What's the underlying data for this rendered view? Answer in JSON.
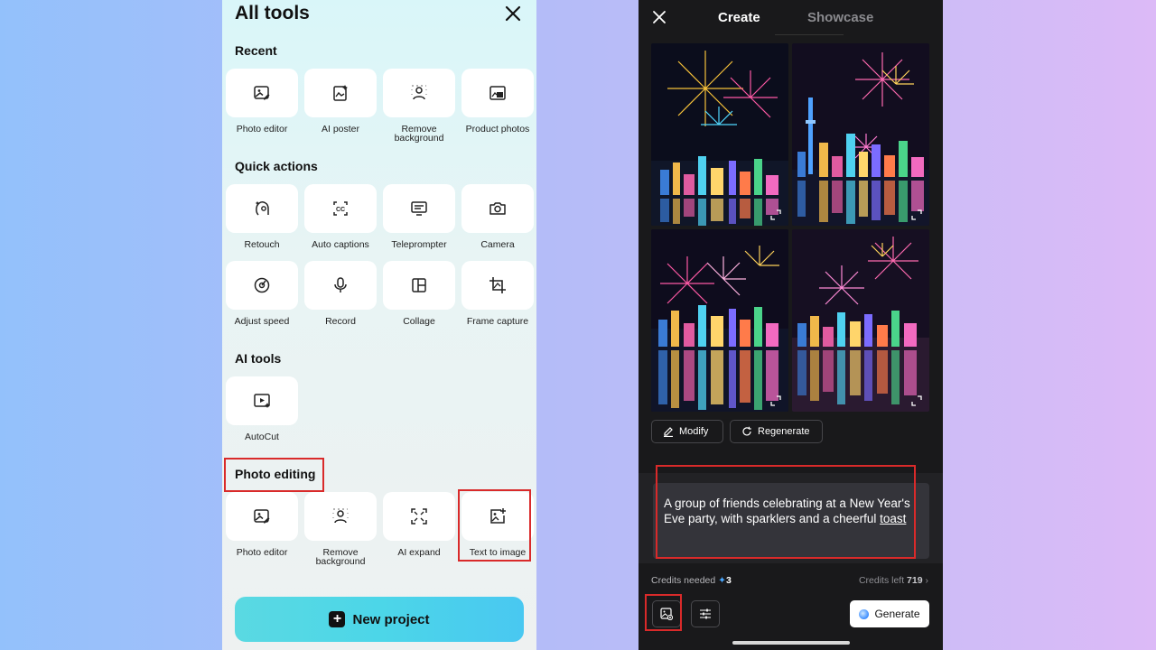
{
  "left_panel": {
    "title": "All tools",
    "sections": {
      "recent": {
        "title": "Recent",
        "items": [
          {
            "label": "Photo editor",
            "icon": "photo-edit-icon"
          },
          {
            "label": "AI poster",
            "icon": "ai-poster-icon"
          },
          {
            "label": "Remove background",
            "icon": "remove-background-icon"
          },
          {
            "label": "Product photos",
            "icon": "product-photos-icon"
          }
        ]
      },
      "quick_actions": {
        "title": "Quick actions",
        "items": [
          {
            "label": "Retouch",
            "icon": "retouch-icon"
          },
          {
            "label": "Auto captions",
            "icon": "captions-icon"
          },
          {
            "label": "Teleprompter",
            "icon": "teleprompter-icon"
          },
          {
            "label": "Camera",
            "icon": "camera-icon"
          },
          {
            "label": "Adjust speed",
            "icon": "speed-icon"
          },
          {
            "label": "Record",
            "icon": "microphone-icon"
          },
          {
            "label": "Collage",
            "icon": "collage-icon"
          },
          {
            "label": "Frame capture",
            "icon": "crop-icon"
          }
        ]
      },
      "ai_tools": {
        "title": "AI tools",
        "items": [
          {
            "label": "AutoCut",
            "icon": "autocut-icon"
          }
        ]
      },
      "photo_editing": {
        "title": "Photo editing",
        "items": [
          {
            "label": "Photo editor",
            "icon": "photo-edit-icon"
          },
          {
            "label": "Remove background",
            "icon": "remove-background-icon"
          },
          {
            "label": "AI expand",
            "icon": "expand-icon"
          },
          {
            "label": "Text to image",
            "icon": "image-plus-icon"
          }
        ]
      }
    },
    "new_project_label": "New project"
  },
  "right_panel": {
    "tabs": [
      {
        "label": "Create",
        "active": true
      },
      {
        "label": "Showcase",
        "active": false
      }
    ],
    "buttons": {
      "modify": "Modify",
      "regenerate": "Regenerate",
      "generate": "Generate"
    },
    "prompt": {
      "text_before": "A group of friends celebrating at a New Year's Eve party, with sparklers and a cheerful ",
      "text_underlined": "toast"
    },
    "credits": {
      "needed_label": "Credits needed",
      "needed_star": "✦",
      "needed_value": "3",
      "left_label": "Credits left",
      "left_value": "719",
      "left_chevron": "›"
    }
  },
  "colors": {
    "highlight": "#d92a2a",
    "accent_cyan": "#4cd6e8",
    "dark_bg": "#19191b"
  }
}
